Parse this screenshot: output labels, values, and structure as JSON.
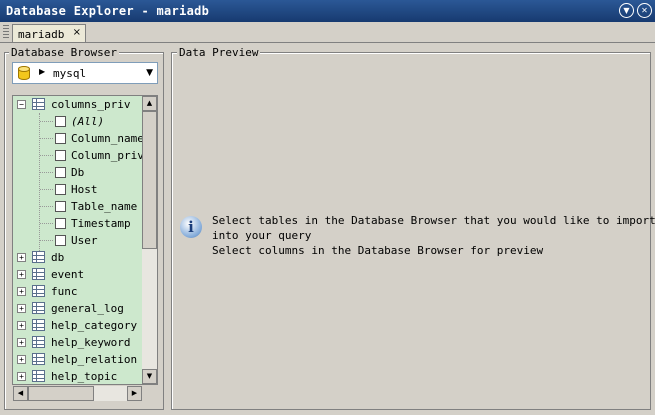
{
  "window": {
    "title": "Database Explorer - mariadb"
  },
  "tabs": [
    {
      "label": "mariadb",
      "close": "×"
    }
  ],
  "browser": {
    "legend": "Database Browser",
    "selected_db": "mysql",
    "tree": {
      "expanded_table": "columns_priv",
      "columns": [
        "(All)",
        "Column_name",
        "Column_priv",
        "Db",
        "Host",
        "Table_name",
        "Timestamp",
        "User"
      ],
      "tables": [
        "db",
        "event",
        "func",
        "general_log",
        "help_category",
        "help_keyword",
        "help_relation",
        "help_topic"
      ]
    }
  },
  "preview": {
    "legend": "Data Preview",
    "messages": [
      "Select tables in the Database Browser that you would like to import",
      "into your query",
      "Select columns in the Database Browser for preview"
    ]
  },
  "colors": {
    "title_bar": "#1f4a86",
    "tree_bg": "#cde8cd",
    "panel_bg": "#d4d0c8"
  }
}
